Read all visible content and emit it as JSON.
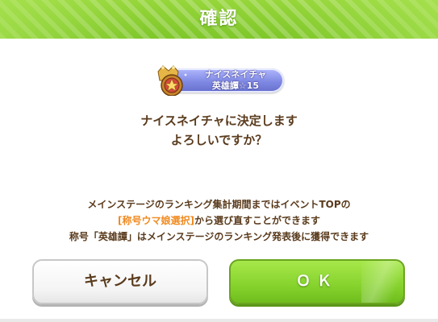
{
  "dialog": {
    "title": "確認",
    "badge": {
      "name": "ナイスネイチャ",
      "rank": "英雄譚☆15",
      "emblem_icon": "crown-emblem-icon",
      "plate_color": "#7f89e3"
    },
    "question_line1": "ナイスネイチャに決定します",
    "question_line2": "よろしいですか？",
    "notes": {
      "line1": "メインステージのランキング集計期間まではイベントTOPの",
      "line2_link": "[称号ウマ娘選択]",
      "line2_rest": "から選び直すことができます",
      "line3": "称号「英雄譚」はメインステージのランキング発表後に獲得できます"
    },
    "buttons": {
      "cancel_label": "キャンセル",
      "ok_label": "ＯＫ"
    }
  },
  "colors": {
    "header_green": "#86d22d",
    "text_brown": "#5a3b1d",
    "accent_orange": "#f08a1f",
    "ok_green": "#86d22d"
  }
}
